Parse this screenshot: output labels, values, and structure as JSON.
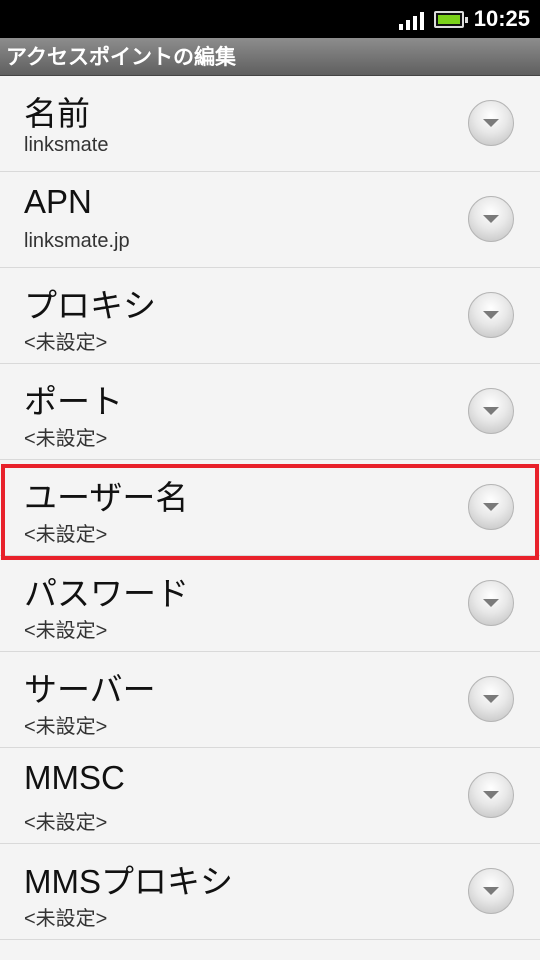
{
  "status": {
    "time": "10:25"
  },
  "header": {
    "title": "アクセスポイントの編集"
  },
  "items": [
    {
      "title": "名前",
      "summary": "linksmate"
    },
    {
      "title": "APN",
      "summary": "linksmate.jp"
    },
    {
      "title": "プロキシ",
      "summary": "<未設定>"
    },
    {
      "title": "ポート",
      "summary": "<未設定>"
    },
    {
      "title": "ユーザー名",
      "summary": "<未設定>"
    },
    {
      "title": "パスワード",
      "summary": "<未設定>"
    },
    {
      "title": "サーバー",
      "summary": "<未設定>"
    },
    {
      "title": "MMSC",
      "summary": "<未設定>"
    },
    {
      "title": "MMSプロキシ",
      "summary": "<未設定>"
    }
  ],
  "colors": {
    "highlight": "#e8212a",
    "battery": "#7bd11a"
  }
}
